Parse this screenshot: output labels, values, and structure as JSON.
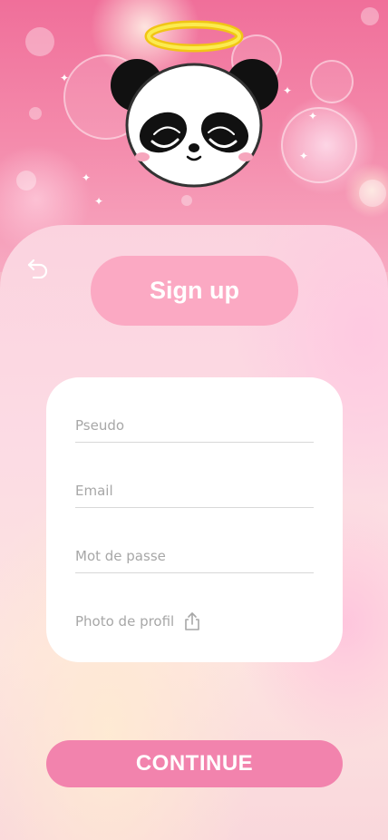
{
  "signup": {
    "title": "Sign up",
    "fields": {
      "pseudo_placeholder": "Pseudo",
      "email_placeholder": "Email",
      "password_placeholder": "Mot de passe"
    },
    "photo_label": "Photo de profil",
    "continue_label": "CONTINUE"
  },
  "icons": {
    "back": "undo-arrow-icon",
    "upload": "upload-icon",
    "mascot": "angel-panda-mascot"
  },
  "colors": {
    "title_pill": "#fba9c3",
    "continue_button": "#f283ad",
    "card": "#ffffff",
    "halo": "#f7e33a"
  }
}
